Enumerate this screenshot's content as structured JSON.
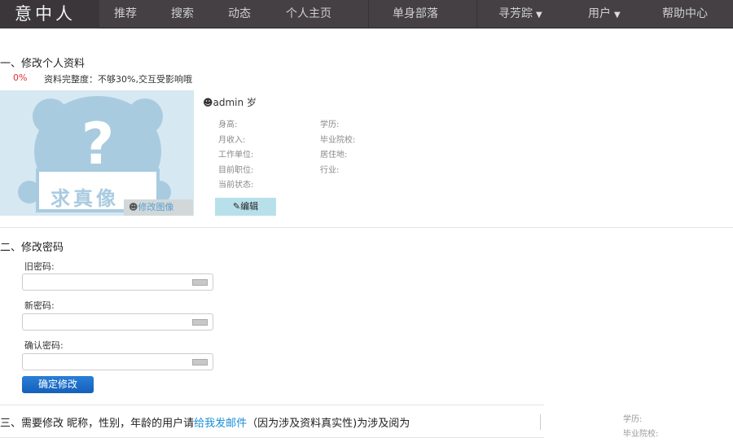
{
  "nav": {
    "logo": "意中人",
    "items": [
      "推荐",
      "搜索",
      "动态",
      "个人主页",
      "单身部落",
      "寻芳踪",
      "用户",
      "帮助中心"
    ]
  },
  "section1": {
    "title": "一、修改个人资料",
    "completeness_pct": "0%",
    "completeness_text": "资料完整度：不够30%,交互受影响哦",
    "username": "admin 岁",
    "left_fields": [
      "身高:",
      "月收入:",
      "工作单位:",
      "目前职位:",
      "当前状态:"
    ],
    "right_fields": [
      "学历:",
      "毕业院校:",
      "居住地:",
      "行业:"
    ],
    "avatar_text": "求真像",
    "change_avatar": "修改图像",
    "edit": "编辑"
  },
  "section2": {
    "title": "二、修改密码",
    "old_label": "旧密码:",
    "new_label": "新密码:",
    "confirm_label": "确认密码:",
    "old_value": "",
    "new_value": "",
    "confirm_value": "",
    "submit": "确定修改"
  },
  "section3": {
    "prefix": "三、需要修改 昵称，性别，年龄的用户请",
    "link": "给我发邮件",
    "suffix": "（因为涉及资料真实性)为涉及阅为"
  },
  "ghost": {
    "fields": [
      "学历:",
      "毕业院校:"
    ]
  },
  "colors": {
    "nav_bg": "#444043",
    "accent": "#1a6fc9",
    "percent": "#e03030",
    "edit_bg": "#b8e0ea"
  }
}
